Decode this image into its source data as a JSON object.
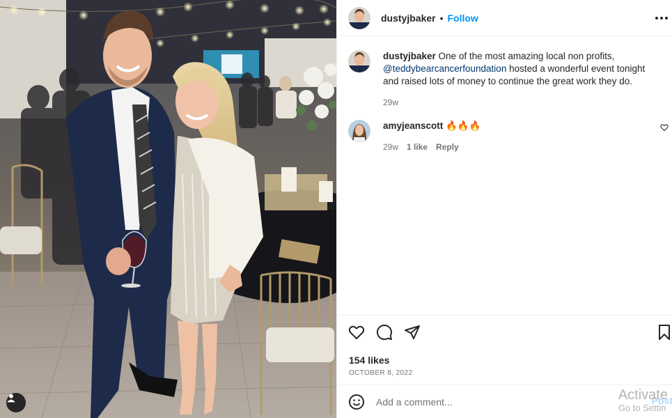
{
  "post": {
    "username": "dustyjbaker",
    "follow_label": "Follow",
    "separator": "•",
    "more_icon": "more-horizontal-icon"
  },
  "comments": [
    {
      "username": "dustyjbaker",
      "text_prefix": "One of the most amazing local non profits,",
      "mention": "@teddybearcancerfoundation",
      "text_suffix": "hosted a wonderful event tonight and raised lots of money to continue the great work they do.",
      "time": "29w"
    },
    {
      "username": "amyjeanscott",
      "text": "🔥🔥🔥",
      "time": "29w",
      "likes": "1 like",
      "reply_label": "Reply"
    }
  ],
  "actions": {
    "like_icon": "heart-icon",
    "comment_icon": "comment-icon",
    "share_icon": "share-icon",
    "save_icon": "bookmark-icon"
  },
  "likes": "154 likes",
  "date": "OCTOBER 8, 2022",
  "add_comment": {
    "placeholder": "Add a comment...",
    "post_label": "Post",
    "emoji_icon": "emoji-icon"
  },
  "photo": {
    "user_tag_icon": "user-tag-icon"
  },
  "watermark": {
    "title": "Activate",
    "subtitle": "Go to Settin"
  },
  "colors": {
    "follow": "#0095f6",
    "mention": "#00376b",
    "meta": "#737373",
    "post_disabled": "#b3dbff"
  }
}
